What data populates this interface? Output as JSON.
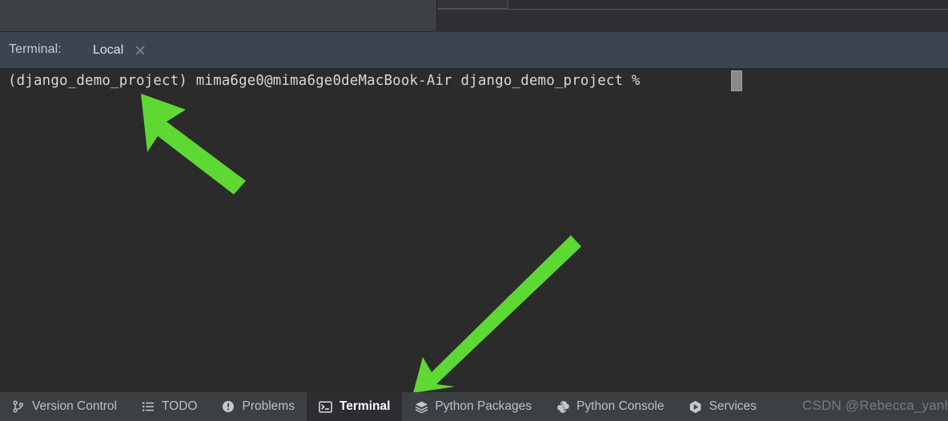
{
  "terminal_panel": {
    "title": "Terminal:",
    "tabs": [
      {
        "label": "Local",
        "close_icon": "close-icon",
        "active": true
      }
    ],
    "add_tab_icon": "plus-icon",
    "dropdown_icon": "chevron-down-icon",
    "accent_color": "#3d82d6",
    "header_bg": "#3c4450"
  },
  "console": {
    "prompt_line": "(django_demo_project) mima6ge0@mima6ge0deMacBook-Air django_demo_project %",
    "cursor": "block-cursor",
    "background": "#2b2b2b",
    "text_color": "#d8d8d8"
  },
  "annotations": {
    "color": "#5ed833",
    "arrows": [
      {
        "name": "arrow-to-venv-prefix",
        "points_to": "(django_demo_project)"
      },
      {
        "name": "arrow-to-terminal-tab",
        "points_to": "Terminal"
      }
    ]
  },
  "status_bar": {
    "items": [
      {
        "label": "Version Control",
        "icon": "branch-icon",
        "active": false
      },
      {
        "label": "TODO",
        "icon": "list-icon",
        "active": false
      },
      {
        "label": "Problems",
        "icon": "error-circle-icon",
        "active": false
      },
      {
        "label": "Terminal",
        "icon": "terminal-icon",
        "active": true
      },
      {
        "label": "Python Packages",
        "icon": "layers-icon",
        "active": false
      },
      {
        "label": "Python Console",
        "icon": "python-icon",
        "active": false
      },
      {
        "label": "Services",
        "icon": "play-hexagon-icon",
        "active": false
      }
    ]
  },
  "watermark": {
    "text": "CSDN @Rebecca_yanhan"
  }
}
